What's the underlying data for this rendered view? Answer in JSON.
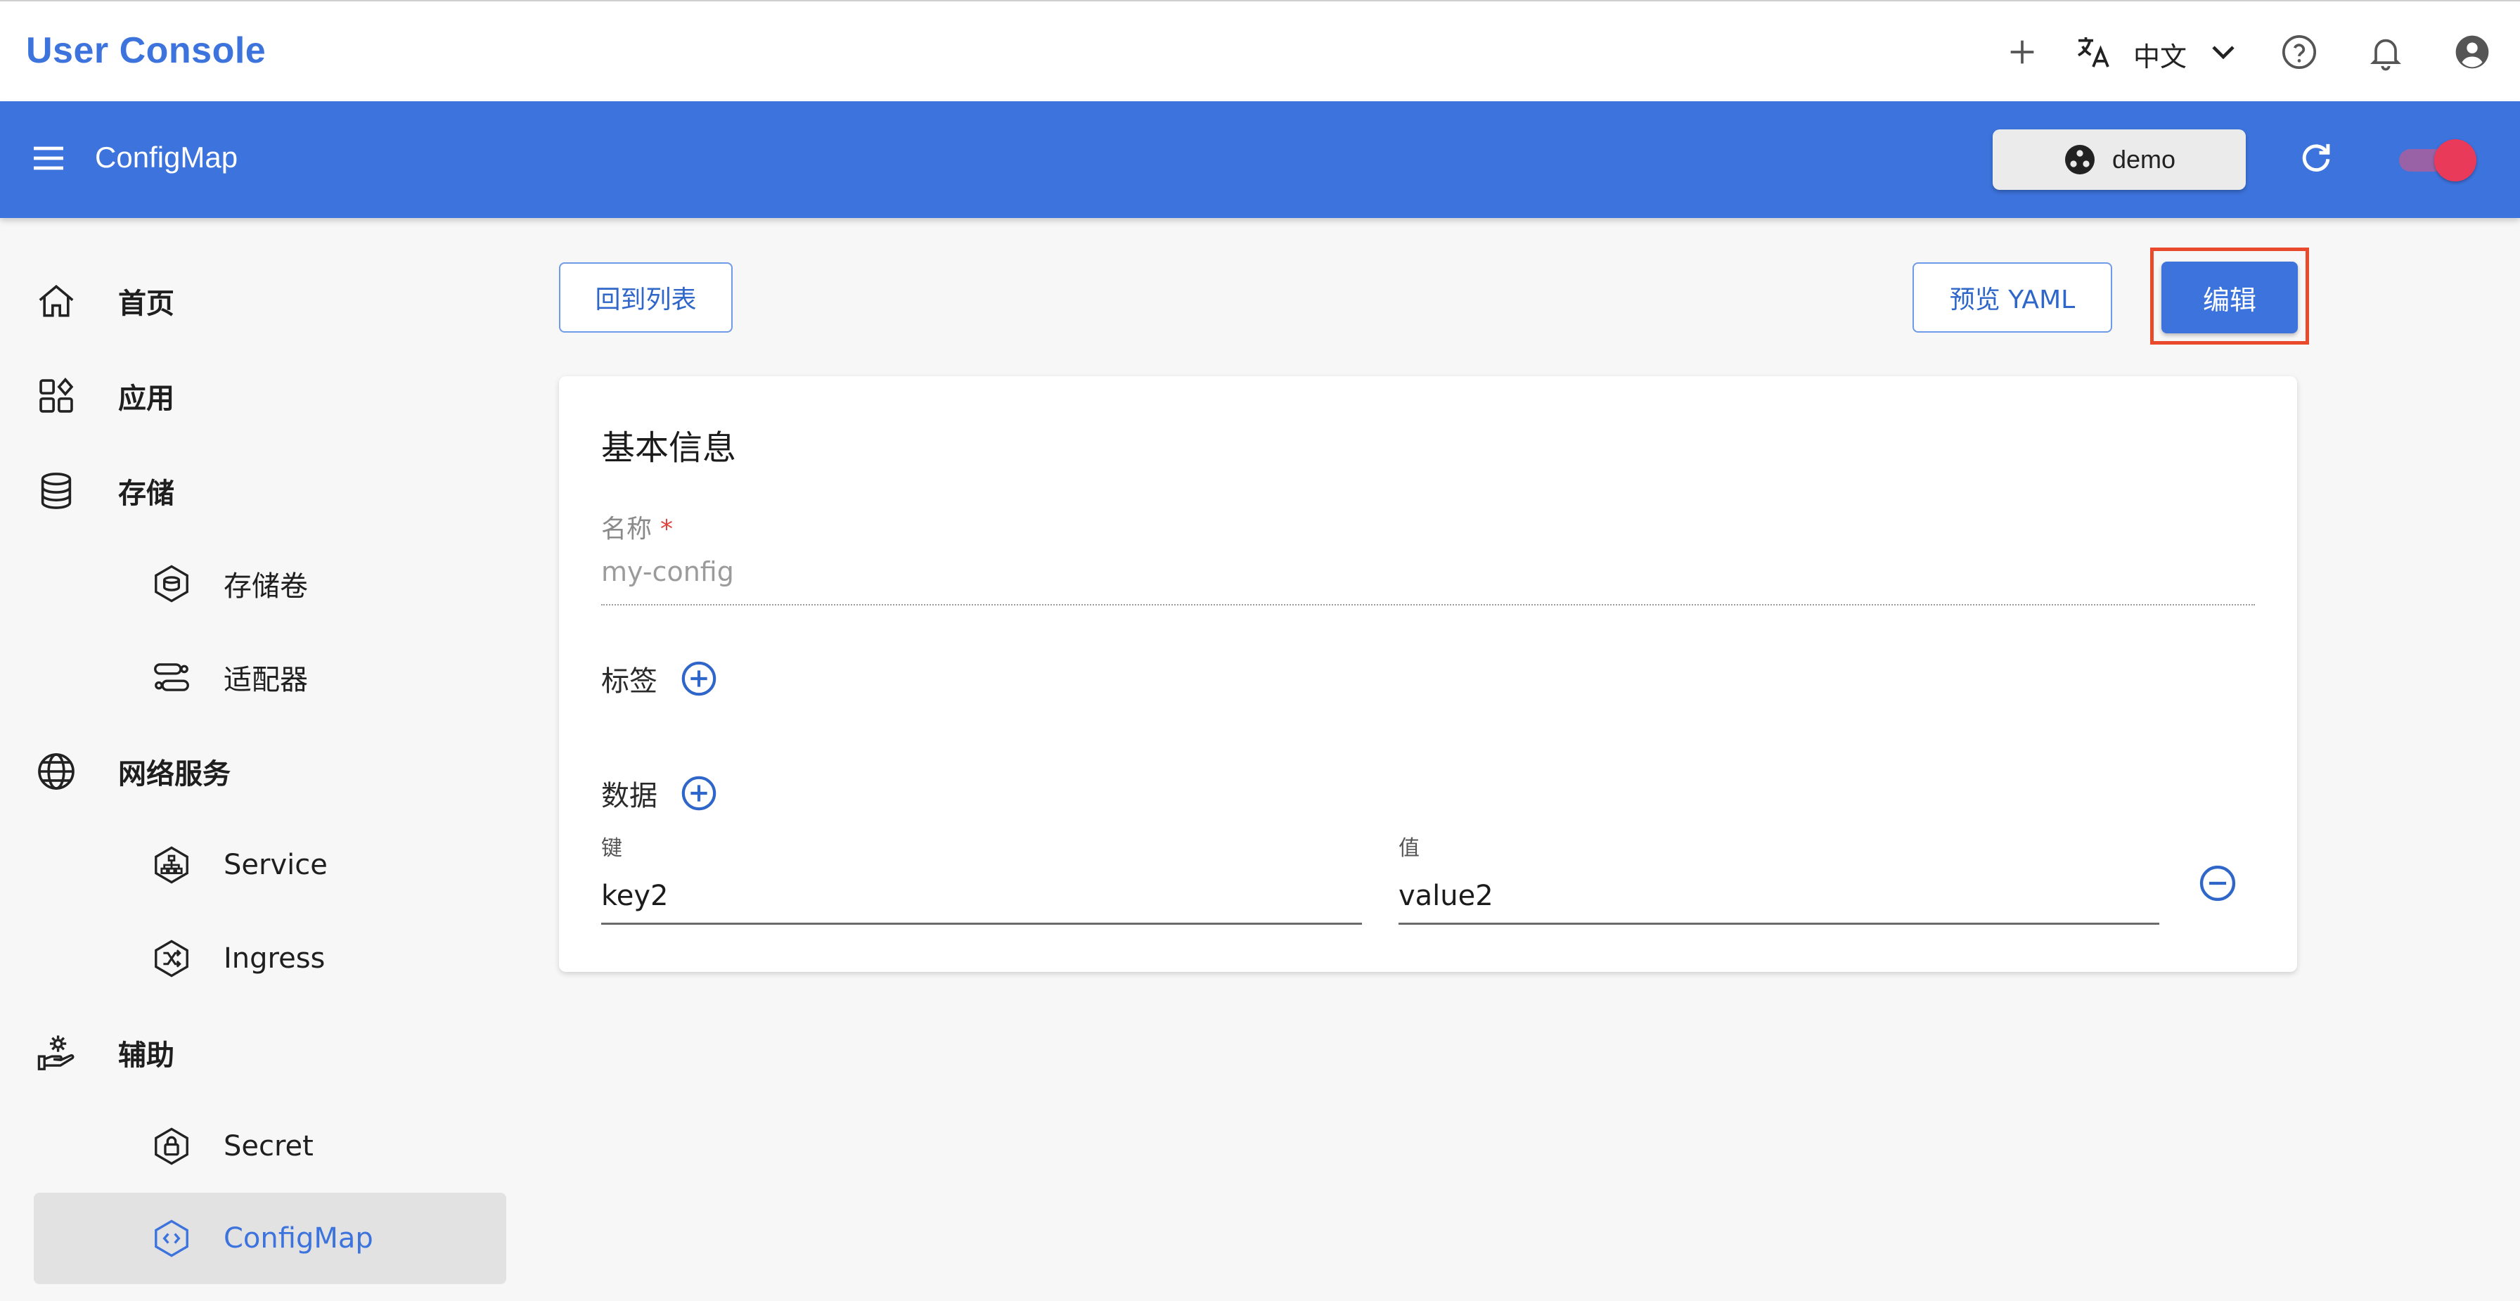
{
  "app": {
    "title": "User Console"
  },
  "header": {
    "language": "中文",
    "icons": [
      "plus-icon",
      "translate-icon",
      "chevron-down-icon",
      "help-icon",
      "bell-icon",
      "account-icon"
    ]
  },
  "toolbar": {
    "title": "ConfigMap",
    "namespace": "demo",
    "toggle_on": true
  },
  "sidebar": {
    "items": [
      {
        "label": "首页",
        "icon": "home-icon"
      },
      {
        "label": "应用",
        "icon": "apps-icon"
      },
      {
        "label": "存储",
        "icon": "database-icon"
      },
      {
        "label": "存储卷",
        "icon": "volume-icon"
      },
      {
        "label": "适配器",
        "icon": "adapter-icon"
      },
      {
        "label": "网络服务",
        "icon": "globe-icon"
      },
      {
        "label": "Service",
        "icon": "service-icon"
      },
      {
        "label": "Ingress",
        "icon": "ingress-icon"
      },
      {
        "label": "辅助",
        "icon": "gear-hand-icon"
      },
      {
        "label": "Secret",
        "icon": "lock-icon"
      },
      {
        "label": "ConfigMap",
        "icon": "configmap-icon"
      }
    ],
    "active": "ConfigMap"
  },
  "actions": {
    "back_label": "回到列表",
    "yaml_label": "预览 YAML",
    "edit_label": "编辑"
  },
  "form": {
    "section_title": "基本信息",
    "name_label": "名称",
    "required_mark": "*",
    "name_value": "my-config",
    "labels_label": "标签",
    "data_label": "数据",
    "key_label": "键",
    "value_label": "值",
    "key_value": "key2",
    "value_value": "value2"
  },
  "colors": {
    "brand": "#3d73dd",
    "highlight": "#e84a2b",
    "toggle_knob": "#ea3a5a"
  }
}
